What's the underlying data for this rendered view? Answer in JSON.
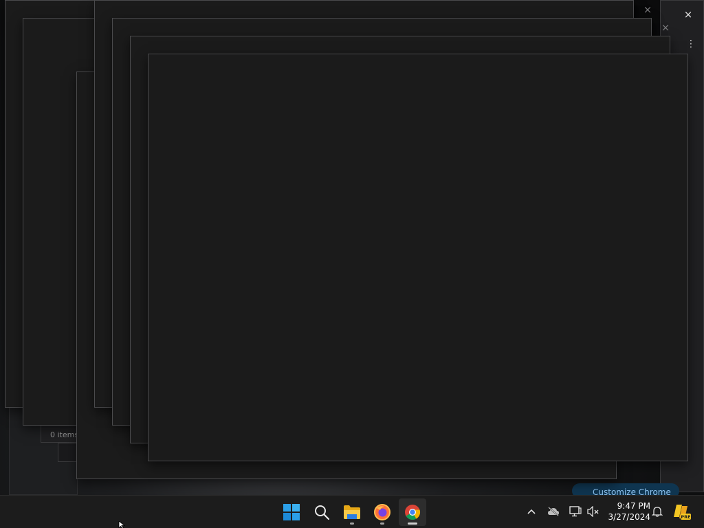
{
  "background_windows": {
    "file_explorer": {
      "status_text": "0 items"
    },
    "chrome": {
      "customize_label": "Customize Chrome"
    },
    "close_glyph": "×",
    "more_glyph": "⋮"
  },
  "taskbar": {
    "apps": [
      {
        "name": "Start",
        "icon": "windows-logo-icon",
        "running": false,
        "active": false
      },
      {
        "name": "Search",
        "icon": "search-icon",
        "running": false,
        "active": false
      },
      {
        "name": "File Explorer",
        "icon": "folder-icon",
        "running": true,
        "active": false
      },
      {
        "name": "Firefox",
        "icon": "firefox-icon",
        "running": true,
        "active": false
      },
      {
        "name": "Google Chrome",
        "icon": "chrome-icon",
        "running": true,
        "active": true
      }
    ],
    "tray": {
      "icons": [
        "chevron-up-icon",
        "onedrive-offline-icon",
        "network-icon",
        "volume-muted-icon"
      ],
      "time": "9:47 PM",
      "date": "3/27/2024",
      "notification_icon": "bell-icon",
      "copilot_badge": "PRE"
    }
  },
  "colors": {
    "taskbar_bg": "#1c1c1c",
    "window_bg": "#1b1b1b",
    "window_border": "#4a4a4c",
    "accent_blue": "#0f6cbd"
  }
}
